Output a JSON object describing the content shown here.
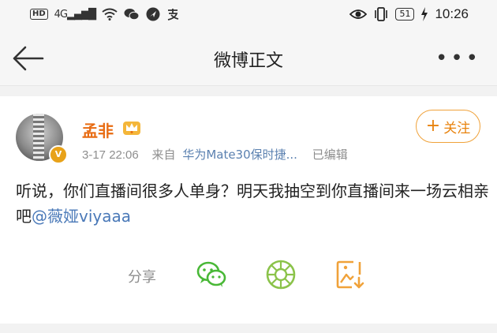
{
  "status_bar": {
    "hd": "HD",
    "signal": "4G",
    "time": "10:26",
    "battery": "51",
    "left_icons": [
      "hd-icon",
      "signal-icon",
      "wifi-icon",
      "wechat-icon",
      "location-icon",
      "alipay-icon"
    ],
    "right_icons": [
      "eye-icon",
      "vibrate-icon",
      "battery-icon",
      "charging-icon"
    ]
  },
  "nav": {
    "title": "微博正文",
    "back_icon": "back-arrow-icon",
    "more_icon": "more-dots-icon"
  },
  "post": {
    "author": "孟非",
    "verified_badge": "V",
    "date": "3-17 22:06",
    "from_label": "来自",
    "device": "华为Mate30保时捷...",
    "edited": "已编辑",
    "follow_plus": "+",
    "follow_label": "关注",
    "content_text": "听说，你们直播间很多人单身？明天我抽空到你直播间来一场云相亲吧",
    "mention": "@薇娅viyaaa"
  },
  "share": {
    "label": "分享",
    "targets": [
      "wechat-icon",
      "moments-icon",
      "save-image-icon"
    ]
  },
  "colors": {
    "accent_orange": "#e86b12",
    "follow_border": "#f0a23a",
    "link_blue": "#4a79b8",
    "wechat_green": "#49b837",
    "moments_green": "#8bc34a",
    "save_orange": "#f0a23a"
  }
}
